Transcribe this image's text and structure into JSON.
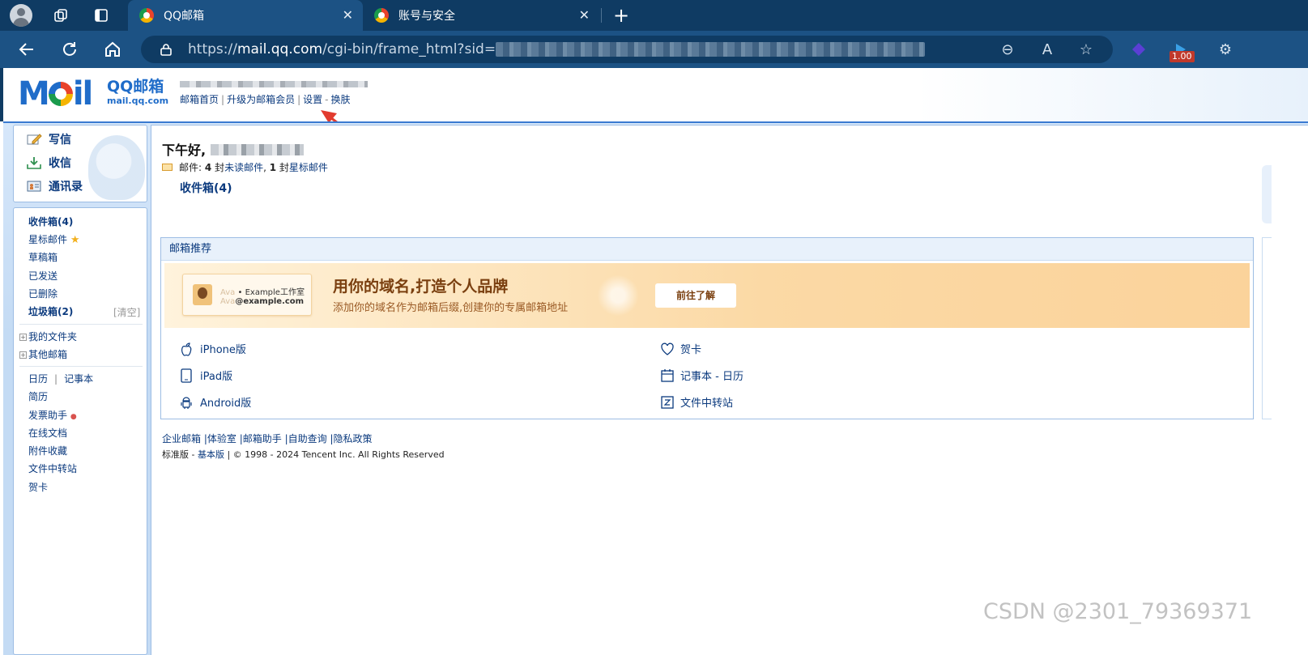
{
  "browser": {
    "tabs": [
      {
        "title": "QQ邮箱",
        "active": true
      },
      {
        "title": "账号与安全",
        "active": false
      }
    ],
    "url": {
      "prefix": "https://",
      "host": "mail.qq.com",
      "path": "/cgi-bin/frame_html?sid="
    },
    "zoom_badge": "1.00"
  },
  "header": {
    "logo_cn": "QQ邮箱",
    "logo_domain": "mail.qq.com",
    "logo_letters": "M",
    "logo_il": "il",
    "links": [
      "邮箱首页",
      "升级为邮箱会员",
      "设置",
      "换肤"
    ]
  },
  "sidebar": {
    "actions": [
      "写信",
      "收信",
      "通讯录"
    ],
    "folders": {
      "inbox": "收件箱(4)",
      "starred": "星标邮件",
      "drafts": "草稿箱",
      "sent": "已发送",
      "deleted": "已删除",
      "spam": "垃圾箱(2)",
      "clear": "[清空]",
      "my_folders": "我的文件夹",
      "other_mail": "其他邮箱"
    },
    "tools": {
      "calendar": "日历",
      "notes": "记事本",
      "resume": "简历",
      "invoice": "发票助手",
      "docs": "在线文档",
      "attachments": "附件收藏",
      "transfer": "文件中转站",
      "cards": "贺卡"
    }
  },
  "main": {
    "greeting": "下午好,",
    "mail_label": "邮件:",
    "unread_count": "4",
    "unread_suffix": " 封",
    "unread_text": "未读邮件",
    "comma": ",",
    "starred_count": "1",
    "starred_suffix": " 封",
    "starred_text": "星标邮件",
    "inbox_link": "收件箱(4)",
    "recommend": {
      "header": "邮箱推荐",
      "card_line1_dim": "Ava",
      "card_line1": "• Example工作室",
      "card_line2_dim": "Ava",
      "card_line2": "@example.com",
      "title": "用你的域名,打造个人品牌",
      "subtitle": "添加你的域名作为邮箱后缀,创建你的专属邮箱地址",
      "button": "前往了解",
      "apps_left": [
        "iPhone版",
        "iPad版",
        "Android版"
      ],
      "apps_right": [
        "贺卡",
        "记事本 - 日历",
        "文件中转站"
      ]
    },
    "footer": {
      "links": [
        "企业邮箱",
        "体验室",
        "邮箱助手",
        "自助查询",
        "隐私政策"
      ],
      "edition_std": "标准版",
      "edition_basic": "基本版",
      "copyright": "© 1998 - 2024 Tencent Inc. All Rights Reserved"
    }
  },
  "watermark": "CSDN @2301_79369371",
  "colors": {
    "chrome_dark": "#0f3b63",
    "chrome": "#1c5284",
    "link": "#0b3a7e",
    "frame_blue": "#3a7ad1",
    "banner_orange": "#fbd39b"
  }
}
